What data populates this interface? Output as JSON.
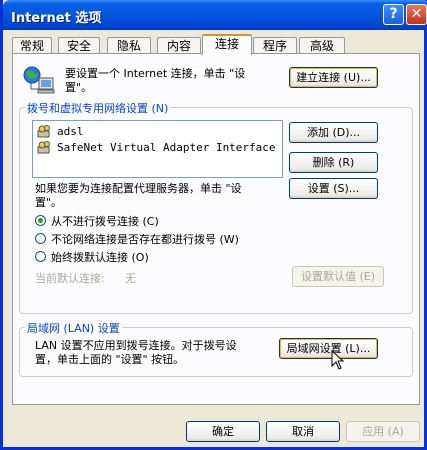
{
  "window": {
    "title": "Internet 选项",
    "help_glyph": "?",
    "close_glyph": "✕"
  },
  "tabs": [
    {
      "label": "常规",
      "active": false
    },
    {
      "label": "安全",
      "active": false
    },
    {
      "label": "隐私",
      "active": false
    },
    {
      "label": "内容",
      "active": false
    },
    {
      "label": "连接",
      "active": true
    },
    {
      "label": "程序",
      "active": false
    },
    {
      "label": "高级",
      "active": false
    }
  ],
  "setup": {
    "text_line1": "要设置一个 Internet 连接，单击 \"设",
    "text_line2": "置\"。",
    "button": "建立连接 (U)..."
  },
  "dialup": {
    "legend": "拨号和虚拟专用网络设置 (N)",
    "items": [
      {
        "label": "adsl"
      },
      {
        "label": "SafeNet Virtual Adapter Interface"
      }
    ],
    "add_button": "添加 (D)...",
    "delete_button": "删除 (R)",
    "proxy_text_line1": "如果您要为连接配置代理服务器，单击 \"设",
    "proxy_text_line2": "置\"。",
    "settings_button": "设置 (S)...",
    "radios": [
      {
        "label": "从不进行拨号连接 (C)",
        "checked": true
      },
      {
        "label": "不论网络连接是否存在都进行拨号 (W)",
        "checked": false
      },
      {
        "label": "始终拨默认连接 (O)",
        "checked": false
      }
    ],
    "current_default_label": "当前默认连接:",
    "current_default_value": "无",
    "set_default_button": "设置默认值 (E)"
  },
  "lan": {
    "legend": "局域网 (LAN) 设置",
    "text_line1": "LAN 设置不应用到拨号连接。对于拨号设",
    "text_line2": "置，单击上面的 \"设置\" 按钮。",
    "button": "局域网设置 (L)..."
  },
  "footer": {
    "ok": "确定",
    "cancel": "取消",
    "apply": "应用 (A)"
  }
}
